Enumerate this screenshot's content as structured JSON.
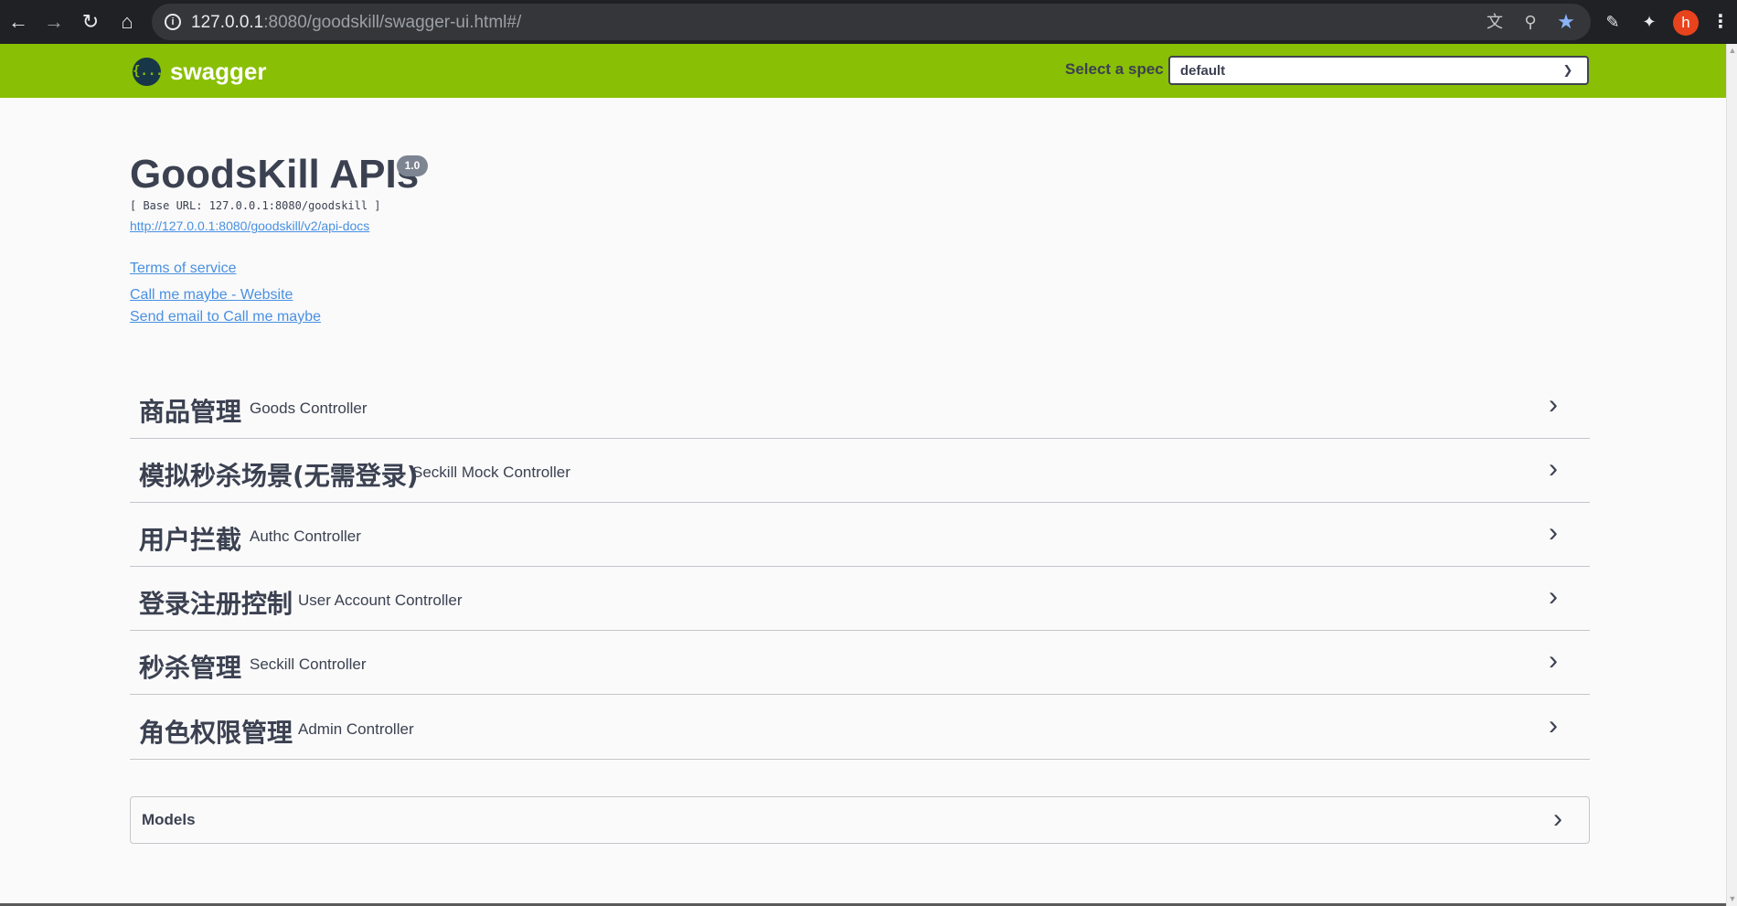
{
  "browser": {
    "url_host": "127.0.0.1",
    "url_rest": ":8080/goodskill/swagger-ui.html#/",
    "back_icon": "back-arrow-icon",
    "forward_icon": "forward-arrow-icon",
    "reload_icon": "reload-icon",
    "home_icon": "home-icon",
    "avatar_letter": "h",
    "avatar_color": "#e8431c"
  },
  "topbar": {
    "logo_symbol": "{...}",
    "logo_text": "swagger",
    "spec_label": "Select a spec",
    "spec_value": "default",
    "color": "#89bf04"
  },
  "info": {
    "title": "GoodsKill APIs",
    "version": "1.0",
    "base_url": "[ Base URL: 127.0.0.1:8080/goodskill ]",
    "api_docs_link": "http://127.0.0.1:8080/goodskill/v2/api-docs",
    "terms_link": "Terms of service",
    "website_link": "Call me maybe - Website",
    "email_link": "Send email to Call me maybe"
  },
  "tags": [
    {
      "name": "商品管理",
      "description": "Goods Controller"
    },
    {
      "name": "模拟秒杀场景(无需登录)",
      "description": "Seckill Mock Controller"
    },
    {
      "name": "用户拦截",
      "description": "Authc Controller"
    },
    {
      "name": "登录注册控制",
      "description": "User Account Controller"
    },
    {
      "name": "秒杀管理",
      "description": "Seckill Controller"
    },
    {
      "name": "角色权限管理",
      "description": "Admin Controller"
    }
  ],
  "models": {
    "title": "Models"
  },
  "colors": {
    "link": "#4990e2",
    "text": "#3b4151",
    "version_badge": "#7d8492"
  }
}
